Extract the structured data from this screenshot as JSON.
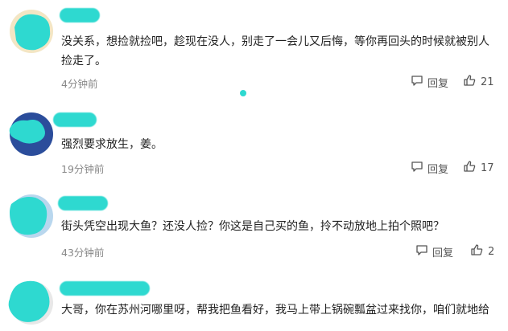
{
  "comments": [
    {
      "text": "没关系，想捡就捡吧，趁现在没人，别走了一会儿又后悔，等你再回头的时候就被别人捡走了。",
      "time": "4分钟前",
      "reply_label": "回复",
      "likes": "21"
    },
    {
      "text": "强烈要求放生，姜。",
      "time": "19分钟前",
      "reply_label": "回复",
      "likes": "17"
    },
    {
      "text": "街头凭空出现大鱼？还没人捡？你这是自己买的鱼，拎不动放地上拍个照吧？",
      "time": "43分钟前",
      "reply_label": "回复",
      "likes": "2"
    },
    {
      "text": "大哥，你在苏州河哪里呀，帮我把鱼看好，我马上带上锅碗瓢盆过来找你，咱们就地给",
      "time": "",
      "reply_label": "",
      "likes": ""
    }
  ],
  "icons": {
    "reply": "comment-bubble-icon",
    "like": "thumbs-up-icon"
  },
  "colors": {
    "redaction": "#2ed9d0",
    "meta_text": "#888888"
  }
}
